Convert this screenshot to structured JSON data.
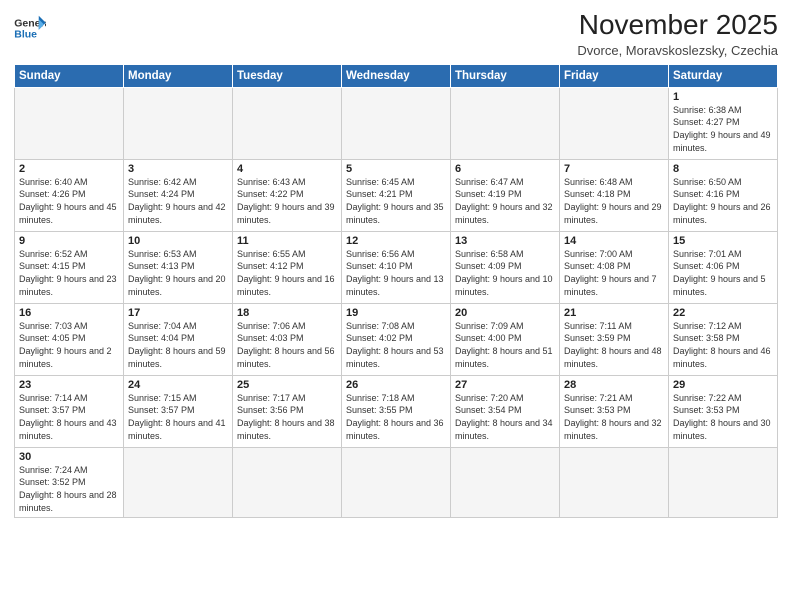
{
  "header": {
    "logo_general": "General",
    "logo_blue": "Blue",
    "month_title": "November 2025",
    "location": "Dvorce, Moravskoslezsky, Czechia"
  },
  "days_of_week": [
    "Sunday",
    "Monday",
    "Tuesday",
    "Wednesday",
    "Thursday",
    "Friday",
    "Saturday"
  ],
  "weeks": [
    [
      {
        "day": "",
        "info": ""
      },
      {
        "day": "",
        "info": ""
      },
      {
        "day": "",
        "info": ""
      },
      {
        "day": "",
        "info": ""
      },
      {
        "day": "",
        "info": ""
      },
      {
        "day": "",
        "info": ""
      },
      {
        "day": "1",
        "info": "Sunrise: 6:38 AM\nSunset: 4:27 PM\nDaylight: 9 hours\nand 49 minutes."
      }
    ],
    [
      {
        "day": "2",
        "info": "Sunrise: 6:40 AM\nSunset: 4:26 PM\nDaylight: 9 hours\nand 45 minutes."
      },
      {
        "day": "3",
        "info": "Sunrise: 6:42 AM\nSunset: 4:24 PM\nDaylight: 9 hours\nand 42 minutes."
      },
      {
        "day": "4",
        "info": "Sunrise: 6:43 AM\nSunset: 4:22 PM\nDaylight: 9 hours\nand 39 minutes."
      },
      {
        "day": "5",
        "info": "Sunrise: 6:45 AM\nSunset: 4:21 PM\nDaylight: 9 hours\nand 35 minutes."
      },
      {
        "day": "6",
        "info": "Sunrise: 6:47 AM\nSunset: 4:19 PM\nDaylight: 9 hours\nand 32 minutes."
      },
      {
        "day": "7",
        "info": "Sunrise: 6:48 AM\nSunset: 4:18 PM\nDaylight: 9 hours\nand 29 minutes."
      },
      {
        "day": "8",
        "info": "Sunrise: 6:50 AM\nSunset: 4:16 PM\nDaylight: 9 hours\nand 26 minutes."
      }
    ],
    [
      {
        "day": "9",
        "info": "Sunrise: 6:52 AM\nSunset: 4:15 PM\nDaylight: 9 hours\nand 23 minutes."
      },
      {
        "day": "10",
        "info": "Sunrise: 6:53 AM\nSunset: 4:13 PM\nDaylight: 9 hours\nand 20 minutes."
      },
      {
        "day": "11",
        "info": "Sunrise: 6:55 AM\nSunset: 4:12 PM\nDaylight: 9 hours\nand 16 minutes."
      },
      {
        "day": "12",
        "info": "Sunrise: 6:56 AM\nSunset: 4:10 PM\nDaylight: 9 hours\nand 13 minutes."
      },
      {
        "day": "13",
        "info": "Sunrise: 6:58 AM\nSunset: 4:09 PM\nDaylight: 9 hours\nand 10 minutes."
      },
      {
        "day": "14",
        "info": "Sunrise: 7:00 AM\nSunset: 4:08 PM\nDaylight: 9 hours\nand 7 minutes."
      },
      {
        "day": "15",
        "info": "Sunrise: 7:01 AM\nSunset: 4:06 PM\nDaylight: 9 hours\nand 5 minutes."
      }
    ],
    [
      {
        "day": "16",
        "info": "Sunrise: 7:03 AM\nSunset: 4:05 PM\nDaylight: 9 hours\nand 2 minutes."
      },
      {
        "day": "17",
        "info": "Sunrise: 7:04 AM\nSunset: 4:04 PM\nDaylight: 8 hours\nand 59 minutes."
      },
      {
        "day": "18",
        "info": "Sunrise: 7:06 AM\nSunset: 4:03 PM\nDaylight: 8 hours\nand 56 minutes."
      },
      {
        "day": "19",
        "info": "Sunrise: 7:08 AM\nSunset: 4:02 PM\nDaylight: 8 hours\nand 53 minutes."
      },
      {
        "day": "20",
        "info": "Sunrise: 7:09 AM\nSunset: 4:00 PM\nDaylight: 8 hours\nand 51 minutes."
      },
      {
        "day": "21",
        "info": "Sunrise: 7:11 AM\nSunset: 3:59 PM\nDaylight: 8 hours\nand 48 minutes."
      },
      {
        "day": "22",
        "info": "Sunrise: 7:12 AM\nSunset: 3:58 PM\nDaylight: 8 hours\nand 46 minutes."
      }
    ],
    [
      {
        "day": "23",
        "info": "Sunrise: 7:14 AM\nSunset: 3:57 PM\nDaylight: 8 hours\nand 43 minutes."
      },
      {
        "day": "24",
        "info": "Sunrise: 7:15 AM\nSunset: 3:57 PM\nDaylight: 8 hours\nand 41 minutes."
      },
      {
        "day": "25",
        "info": "Sunrise: 7:17 AM\nSunset: 3:56 PM\nDaylight: 8 hours\nand 38 minutes."
      },
      {
        "day": "26",
        "info": "Sunrise: 7:18 AM\nSunset: 3:55 PM\nDaylight: 8 hours\nand 36 minutes."
      },
      {
        "day": "27",
        "info": "Sunrise: 7:20 AM\nSunset: 3:54 PM\nDaylight: 8 hours\nand 34 minutes."
      },
      {
        "day": "28",
        "info": "Sunrise: 7:21 AM\nSunset: 3:53 PM\nDaylight: 8 hours\nand 32 minutes."
      },
      {
        "day": "29",
        "info": "Sunrise: 7:22 AM\nSunset: 3:53 PM\nDaylight: 8 hours\nand 30 minutes."
      }
    ],
    [
      {
        "day": "30",
        "info": "Sunrise: 7:24 AM\nSunset: 3:52 PM\nDaylight: 8 hours\nand 28 minutes."
      },
      {
        "day": "",
        "info": ""
      },
      {
        "day": "",
        "info": ""
      },
      {
        "day": "",
        "info": ""
      },
      {
        "day": "",
        "info": ""
      },
      {
        "day": "",
        "info": ""
      },
      {
        "day": "",
        "info": ""
      }
    ]
  ]
}
